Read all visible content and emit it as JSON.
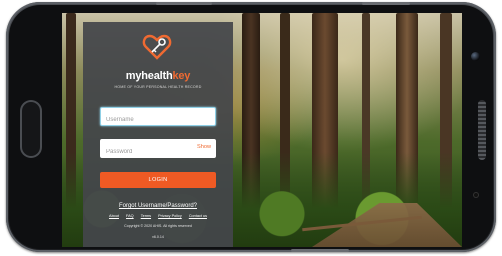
{
  "brand": {
    "name_part1": "myhealth",
    "name_part2": "key",
    "tagline": "HOME OF YOUR PERSONAL HEALTH RECORD"
  },
  "login": {
    "username_placeholder": "Username",
    "password_placeholder": "Password",
    "show_label": "Show",
    "button_label": "LOGIN",
    "forgot_label": "Forgot Username/Password?"
  },
  "footer": {
    "links": [
      "About",
      "FAQ",
      "Terms",
      "Privacy Policy",
      "Contact us"
    ],
    "copyright": "Copyright © 2020 AHIS. All rights reserved",
    "version": "v6.0.14"
  },
  "colors": {
    "accent": "#ef5a24",
    "panel": "#44464a",
    "focus_border": "#8fd0e6"
  },
  "icons": {
    "logo": "heart-key-icon"
  }
}
